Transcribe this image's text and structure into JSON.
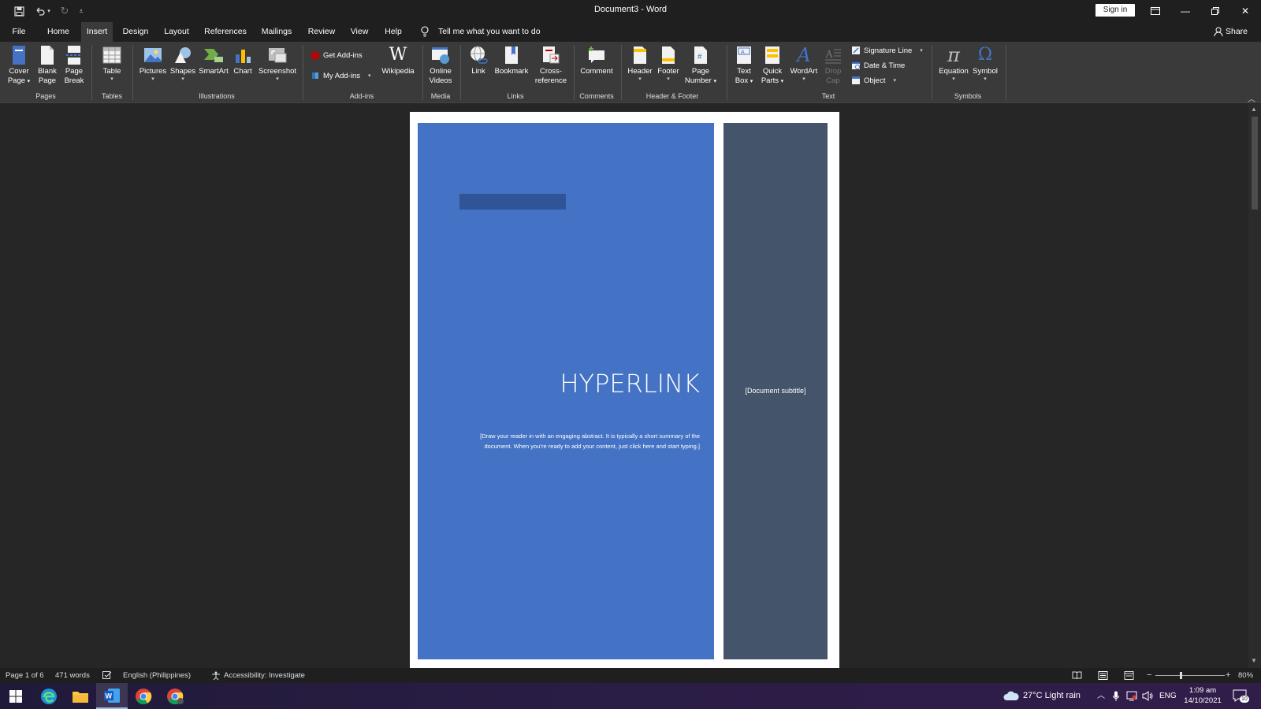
{
  "window": {
    "title": "Document3  -  Word",
    "sign_in": "Sign in"
  },
  "tabs": [
    "File",
    "Home",
    "Insert",
    "Design",
    "Layout",
    "References",
    "Mailings",
    "Review",
    "View",
    "Help"
  ],
  "active_tab": "Insert",
  "tell_me": "Tell me what you want to do",
  "share": "Share",
  "ribbon": {
    "pages": {
      "cover_page": "Cover",
      "cover_page2": "Page",
      "blank_page": "Blank",
      "blank_page2": "Page",
      "page_break": "Page",
      "page_break2": "Break",
      "label": "Pages"
    },
    "tables": {
      "table": "Table",
      "label": "Tables"
    },
    "illustrations": {
      "pictures": "Pictures",
      "shapes": "Shapes",
      "smartart": "SmartArt",
      "chart": "Chart",
      "screenshot": "Screenshot",
      "label": "Illustrations"
    },
    "addins": {
      "get_addins": "Get Add-ins",
      "my_addins": "My Add-ins",
      "wikipedia": "Wikipedia",
      "label": "Add-ins"
    },
    "media": {
      "online_videos": "Online",
      "online_videos2": "Videos",
      "label": "Media"
    },
    "links": {
      "link": "Link",
      "bookmark": "Bookmark",
      "cross_reference": "Cross-",
      "cross_reference2": "reference",
      "label": "Links"
    },
    "comments": {
      "comment": "Comment",
      "label": "Comments"
    },
    "header_footer": {
      "header": "Header",
      "footer": "Footer",
      "page_number": "Page",
      "page_number2": "Number",
      "label": "Header & Footer"
    },
    "text": {
      "text_box": "Text",
      "text_box2": "Box",
      "quick_parts": "Quick",
      "quick_parts2": "Parts",
      "wordart": "WordArt",
      "drop_cap": "Drop",
      "drop_cap2": "Cap",
      "signature_line": "Signature Line",
      "date_time": "Date & Time",
      "object": "Object",
      "label": "Text"
    },
    "symbols": {
      "equation": "Equation",
      "symbol": "Symbol",
      "label": "Symbols"
    }
  },
  "document": {
    "title": "HYPERLINK",
    "abstract": "[Draw your reader in with an engaging abstract. It is typically a short summary of the document. When you’re ready to add your content, just click here and start typing.]",
    "subtitle": "[Document subtitle]"
  },
  "status": {
    "page": "Page 1 of 6",
    "words": "471 words",
    "language": "English (Philippines)",
    "accessibility": "Accessibility: Investigate",
    "zoom": "80%"
  },
  "taskbar": {
    "weather": "27°C  Light rain",
    "lang": "ENG",
    "time": "1:09 am",
    "date": "14/10/2021",
    "notifications": "10"
  },
  "colors": {
    "cover_blue": "#4472c4",
    "cover_side": "#44546a",
    "ribbon_bg": "#3a3a3a",
    "titlebar_bg": "#1f1f1f"
  }
}
